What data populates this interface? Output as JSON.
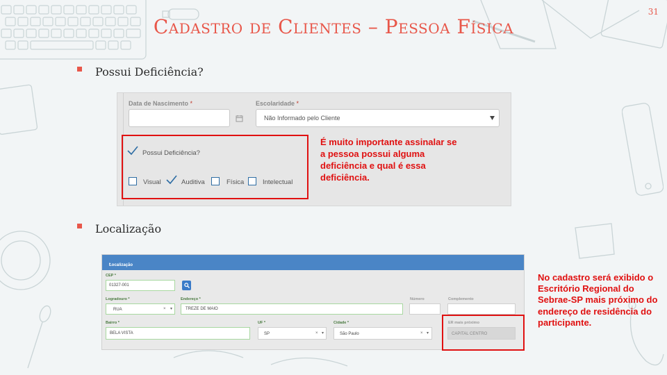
{
  "slide": {
    "title": "Cadastro de Clientes – Pessoa Física",
    "page_number": "31",
    "accent_color": "#e8574a"
  },
  "bullets": [
    {
      "text": "Possui Deficiência?"
    },
    {
      "text": "Localização"
    }
  ],
  "form1": {
    "birth_label": "Data de Nascimento",
    "birth_value": "",
    "education_label": "Escolaridade",
    "education_value": "Não Informado pelo Cliente",
    "required_mark": "*",
    "deficiency_label": "Possui Deficiência?",
    "deficiency_checked": true,
    "options": [
      {
        "label": "Visual",
        "checked": false
      },
      {
        "label": "Auditiva",
        "checked": true
      },
      {
        "label": "Física",
        "checked": false
      },
      {
        "label": "Intelectual",
        "checked": false
      }
    ]
  },
  "note1": "É muito importante assinalar se a pessoa possui alguma deficiência e qual é essa deficiência.",
  "form2": {
    "section_title": "Localização",
    "cep_label": "CEP",
    "cep_value": "01327-001",
    "logradouro_label": "Logradouro",
    "logradouro_value": "RUA",
    "endereco_label": "Endereço",
    "endereco_value": "TREZE DE MAIO",
    "numero_label": "Número",
    "numero_value": "",
    "complemento_label": "Complemento",
    "complemento_value": "",
    "bairro_label": "Bairro",
    "bairro_value": "BELA VISTA",
    "uf_label": "UF",
    "uf_value": "SP",
    "cidade_label": "Cidade",
    "cidade_value": "São Paulo",
    "er_label": "ER mais próximo",
    "er_value": "CAPITAL CENTRO",
    "required_mark": "*"
  },
  "note2": "No cadastro será exibido o Escritório Regional do Sebrae-SP mais próximo do endereço de residência do participante."
}
